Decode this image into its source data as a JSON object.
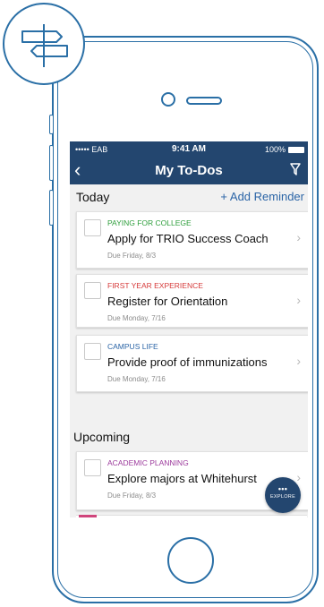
{
  "status_bar": {
    "carrier": "••••• EAB",
    "time": "9:41 AM",
    "battery": "100%"
  },
  "nav": {
    "back_icon": "‹",
    "title": "My To-Dos",
    "filter_icon": "filter-icon"
  },
  "today": {
    "label": "Today",
    "add_reminder": "+ Add Reminder",
    "items": [
      {
        "category": "PAYING FOR COLLEGE",
        "category_color": "#2e9e3c",
        "title": "Apply for TRIO Success Coach",
        "due": "Due Friday, 8/3"
      },
      {
        "category": "FIRST YEAR EXPERIENCE",
        "category_color": "#d63a3a",
        "title": "Register for Orientation",
        "due": "Due Monday, 7/16"
      },
      {
        "category": "CAMPUS LIFE",
        "category_color": "#2a64a6",
        "title": "Provide proof of immunizations",
        "due": "Due Monday, 7/16"
      }
    ]
  },
  "upcoming": {
    "label": "Upcoming",
    "items": [
      {
        "category": "ACADEMIC PLANNING",
        "category_color": "#9c3a9c",
        "title": "Explore majors at Whitehurst",
        "due": "Due Friday, 8/3"
      }
    ]
  },
  "explore_button": {
    "dots": "•••",
    "label": "EXPLORE"
  },
  "colors": {
    "accent": "#23466f",
    "outline": "#2a6fa6",
    "link": "#2a64a6"
  },
  "icons": {
    "logo": "signpost-icon",
    "chevron": "›"
  }
}
